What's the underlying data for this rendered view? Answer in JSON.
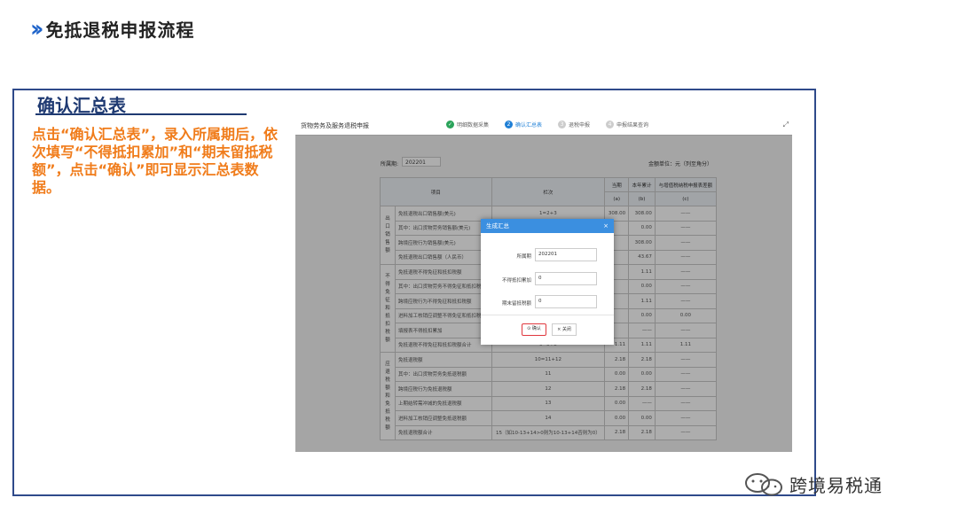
{
  "header": {
    "title": "免抵退税申报流程"
  },
  "section": {
    "title": "确认汇总表",
    "description": "点击“确认汇总表”，录入所属期后，依次填写“不得抵扣累加”和“期末留抵税额”，点击“确认”即可显示汇总表数据。"
  },
  "screenshot": {
    "app_title": "货物劳务及服务退税申报",
    "steps": [
      {
        "label": "明细数据采集",
        "status": "done"
      },
      {
        "label": "确认汇总表",
        "status": "active",
        "num": "2"
      },
      {
        "label": "退税申报",
        "status": "pending",
        "num": "3"
      },
      {
        "label": "申报结果查询",
        "status": "pending",
        "num": "4"
      }
    ],
    "expand_icon": "expand-icon",
    "period_label": "所属期:",
    "period_value": "202201",
    "unit_label": "金额单位：元（列至角分）",
    "table": {
      "headers": [
        "项目",
        "栏次",
        "当期",
        "本年累计",
        "与增值税纳税申报表差额"
      ],
      "subheaders": [
        "(a)",
        "(b)",
        "(c)"
      ],
      "groups": [
        "出口销售额",
        "不得免征和抵扣税额",
        "应退税额和免抵税额"
      ],
      "rows": [
        {
          "item": "免抵退税出口销售额(美元)",
          "col": "1=2+3",
          "cur": "308.00",
          "ytd": "308.00",
          "diff": "——"
        },
        {
          "item": "其中：出口货物劳务销售额(美元)",
          "col": "",
          "cur": "",
          "ytd": "0.00",
          "diff": "——"
        },
        {
          "item": "跨境应税行为销售额(美元)",
          "col": "",
          "cur": "",
          "ytd": "308.00",
          "diff": "——"
        },
        {
          "item": "免抵退税出口销售额（人民币）",
          "col": "",
          "cur": "",
          "ytd": "43.67",
          "diff": "——"
        },
        {
          "item": "免抵退税不得免征和抵扣税额",
          "col": "",
          "cur": "",
          "ytd": "1.11",
          "diff": "——"
        },
        {
          "item": "其中：出口货物劳务不得免征和抵扣税额",
          "col": "",
          "cur": "",
          "ytd": "0.00",
          "diff": "——"
        },
        {
          "item": "跨境应税行为不得免征和抵扣税额",
          "col": "",
          "cur": "",
          "ytd": "1.11",
          "diff": "——"
        },
        {
          "item": "进料加工核销应调整不得免征和抵扣税额",
          "col": "",
          "cur": "",
          "ytd": "0.00",
          "diff": "0.00"
        },
        {
          "item": "填报表不得抵扣累加",
          "col": "",
          "cur": "",
          "ytd": "——",
          "diff": "——"
        },
        {
          "item": "免抵退税不得免征和抵扣税额合计",
          "col": "9=5+8",
          "cur": "1.11",
          "ytd": "1.11",
          "diff": "1.11"
        },
        {
          "item": "免抵退税额",
          "col": "10=11+12",
          "cur": "2.18",
          "ytd": "2.18",
          "diff": "——"
        },
        {
          "item": "其中：出口货物劳务免抵退税额",
          "col": "11",
          "cur": "0.00",
          "ytd": "0.00",
          "diff": "——"
        },
        {
          "item": "跨境应税行为免抵退税额",
          "col": "12",
          "cur": "2.18",
          "ytd": "2.18",
          "diff": "——"
        },
        {
          "item": "上期结转需冲减的免抵退税额",
          "col": "13",
          "cur": "0.00",
          "ytd": "——",
          "diff": "——"
        },
        {
          "item": "进料加工核销应调整免抵退税额",
          "col": "14",
          "cur": "0.00",
          "ytd": "0.00",
          "diff": "——"
        },
        {
          "item": "免抵退税额合计",
          "col": "15（如10-13+14>0则为10-13+14否则为0）",
          "cur": "2.18",
          "ytd": "2.18",
          "diff": "——"
        }
      ]
    },
    "modal": {
      "title": "生成汇总",
      "close": "×",
      "fields": [
        {
          "label": "所属期",
          "value": "202201"
        },
        {
          "label": "不得抵扣累加",
          "value": "0"
        },
        {
          "label": "期末留抵税额",
          "value": "0"
        }
      ],
      "confirm_label": "确认",
      "cancel_label": "关闭"
    }
  },
  "watermark": {
    "text": "跨境易税通"
  }
}
